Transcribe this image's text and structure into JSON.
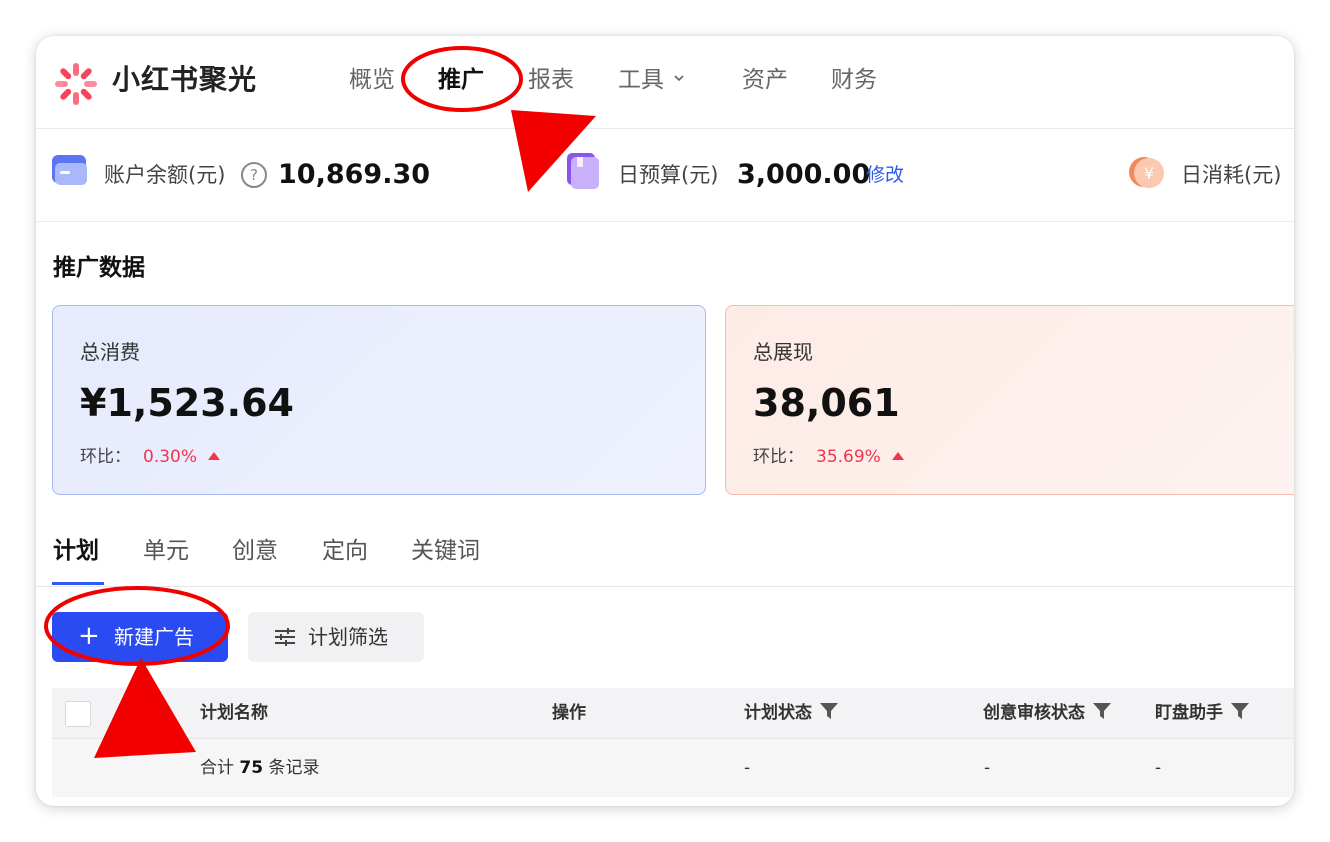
{
  "header": {
    "brand": "小红书聚光",
    "nav": [
      "概览",
      "推广",
      "报表",
      "工具",
      "资产",
      "财务"
    ],
    "active_nav": "推广"
  },
  "stats": {
    "balance_label": "账户余额(元)",
    "balance_value": "10,869.30",
    "budget_label": "日预算(元)",
    "budget_value": "3,000.00",
    "budget_edit": "修改",
    "spend_label": "日消耗(元)"
  },
  "section": {
    "title": "推广数据",
    "cards": [
      {
        "label": "总消费",
        "value": "¥1,523.64",
        "ratio_label": "环比：",
        "ratio_value": "0.30%"
      },
      {
        "label": "总展现",
        "value": "38,061",
        "ratio_label": "环比：",
        "ratio_value": "35.69%"
      }
    ]
  },
  "tabs": [
    "计划",
    "单元",
    "创意",
    "定向",
    "关键词"
  ],
  "active_tab": "计划",
  "toolbar": {
    "new_ad_label": "新建广告",
    "filter_label": "计划筛选"
  },
  "table": {
    "columns": [
      "计划名称",
      "操作",
      "计划状态",
      "创意审核状态",
      "盯盘助手"
    ],
    "summary": {
      "prefix": "合计",
      "count": "75",
      "suffix": "条记录"
    },
    "summary_cells": [
      "-",
      "-",
      "-"
    ]
  },
  "colors": {
    "accent": "#2b4bf2",
    "annotation": "#f20000",
    "up": "#f0364c"
  }
}
